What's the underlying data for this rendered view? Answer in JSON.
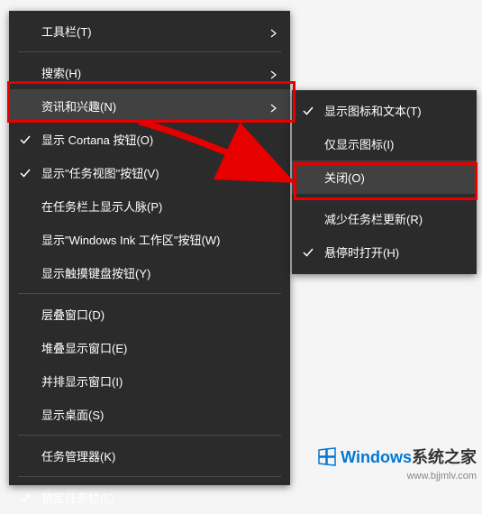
{
  "primary_menu": {
    "items": [
      {
        "label": "工具栏(T)",
        "submenu": true
      },
      {
        "separator": true
      },
      {
        "label": "搜索(H)",
        "submenu": true
      },
      {
        "label": "资讯和兴趣(N)",
        "submenu": true,
        "hovered": true
      },
      {
        "label": "显示 Cortana 按钮(O)",
        "checked": true
      },
      {
        "label": "显示\"任务视图\"按钮(V)",
        "checked": true
      },
      {
        "label": "在任务栏上显示人脉(P)"
      },
      {
        "label": "显示\"Windows Ink 工作区\"按钮(W)"
      },
      {
        "label": "显示触摸键盘按钮(Y)"
      },
      {
        "separator": true
      },
      {
        "label": "层叠窗口(D)"
      },
      {
        "label": "堆叠显示窗口(E)"
      },
      {
        "label": "并排显示窗口(I)"
      },
      {
        "label": "显示桌面(S)"
      },
      {
        "separator": true
      },
      {
        "label": "任务管理器(K)"
      },
      {
        "separator": true
      },
      {
        "label": "锁定任务栏(L)",
        "checked": true
      }
    ]
  },
  "secondary_menu": {
    "items": [
      {
        "label": "显示图标和文本(T)",
        "checked": true
      },
      {
        "label": "仅显示图标(I)"
      },
      {
        "label": "关闭(O)",
        "hovered": true
      },
      {
        "separator": true
      },
      {
        "label": "减少任务栏更新(R)"
      },
      {
        "label": "悬停时打开(H)",
        "checked": true
      }
    ]
  },
  "watermark": {
    "brand_a": "Windows",
    "brand_b": "系统之家",
    "url": "www.bjjmlv.com"
  }
}
